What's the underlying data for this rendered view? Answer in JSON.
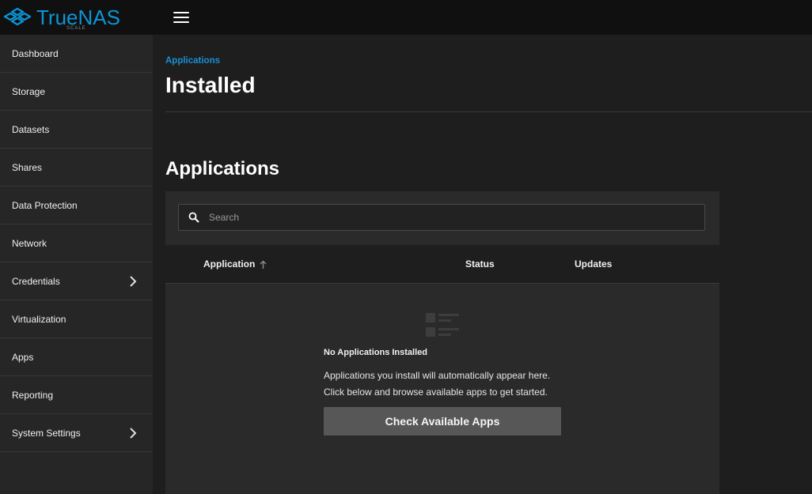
{
  "brand": {
    "name": "TrueNAS",
    "edition": "SCALE",
    "color": "#0a95d6"
  },
  "topbar": {
    "menu_icon": "hamburger-menu-icon"
  },
  "sidebar": {
    "items": [
      {
        "label": "Dashboard"
      },
      {
        "label": "Storage"
      },
      {
        "label": "Datasets"
      },
      {
        "label": "Shares"
      },
      {
        "label": "Data Protection"
      },
      {
        "label": "Network"
      },
      {
        "label": "Credentials",
        "icon": "chevron-right-icon"
      },
      {
        "label": "Virtualization"
      },
      {
        "label": "Apps"
      },
      {
        "label": "Reporting"
      },
      {
        "label": "System Settings",
        "icon": "chevron-right-icon"
      }
    ]
  },
  "header": {
    "breadcrumb": "Applications",
    "title": "Installed"
  },
  "section": {
    "title": "Applications"
  },
  "search": {
    "placeholder": "Search",
    "value": ""
  },
  "table": {
    "columns": [
      {
        "label": "Application",
        "sort": "ascending"
      },
      {
        "label": "Status"
      },
      {
        "label": "Updates"
      }
    ]
  },
  "empty_state": {
    "icon": "list-placeholder-icon",
    "title": "No Applications Installed",
    "line1": "Applications you install will automatically appear here.",
    "line2": "Click below and browse available apps to get started.",
    "button": "Check Available Apps"
  }
}
